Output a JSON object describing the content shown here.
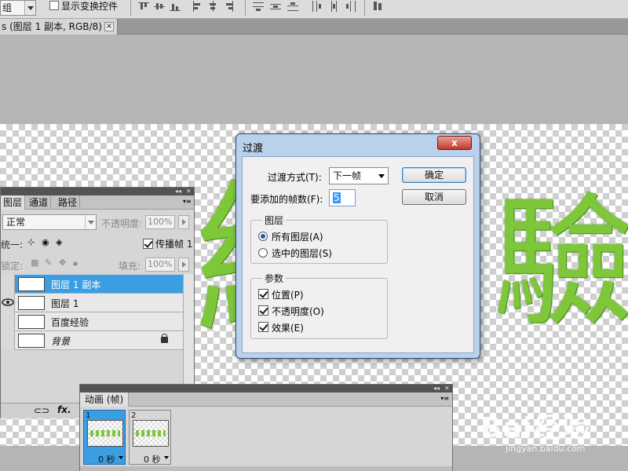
{
  "options_bar": {
    "group_combo": "组",
    "show_transform_controls": "显示变换控件"
  },
  "document": {
    "tab_title": "s (图层 1 副本, RGB/8) *",
    "close_glyph": "×"
  },
  "canvas_text": {
    "left_glyph": "經",
    "right_glyph": "驗"
  },
  "layers_panel": {
    "tabs": [
      "图层",
      "通道",
      "路径"
    ],
    "blend_mode": "正常",
    "opacity_label": "不透明度:",
    "opacity_value": "100%",
    "unify_label": "统一:",
    "propagate_label": "传播帧 1",
    "lock_label": "锁定:",
    "fill_label": "填充:",
    "fill_value": "100%",
    "layers": [
      {
        "name": "图层 1 副本",
        "selected": true,
        "visible": false
      },
      {
        "name": "图层 1",
        "selected": false,
        "visible": true
      },
      {
        "name": "百度经验",
        "selected": false,
        "visible": false
      },
      {
        "name": "背景",
        "selected": false,
        "visible": false,
        "locked": true
      }
    ],
    "fx_label": "fx."
  },
  "animation_panel": {
    "tab": "动画 (帧)",
    "frames": [
      {
        "number": "1",
        "duration": "0 秒"
      },
      {
        "number": "2",
        "duration": "0 秒"
      }
    ]
  },
  "dialog": {
    "title": "过渡",
    "close_label": "x",
    "tween_with_label": "过渡方式(T):",
    "tween_with_value": "下一帧",
    "frames_to_add_label": "要添加的帧数(F):",
    "frames_to_add_value": "5",
    "ok_label": "确定",
    "cancel_label": "取消",
    "layers_group": {
      "title": "图层",
      "options": [
        {
          "label": "所有图层(A)",
          "checked": true
        },
        {
          "label": "选中的图层(S)",
          "checked": false
        }
      ]
    },
    "params_group": {
      "title": "参数",
      "options": [
        {
          "label": "位置(P)",
          "checked": true
        },
        {
          "label": "不透明度(O)",
          "checked": true
        },
        {
          "label": "效果(E)",
          "checked": true
        }
      ]
    }
  },
  "watermark": {
    "logo": "Bai经验",
    "url": "jingyan.baidu.com"
  }
}
